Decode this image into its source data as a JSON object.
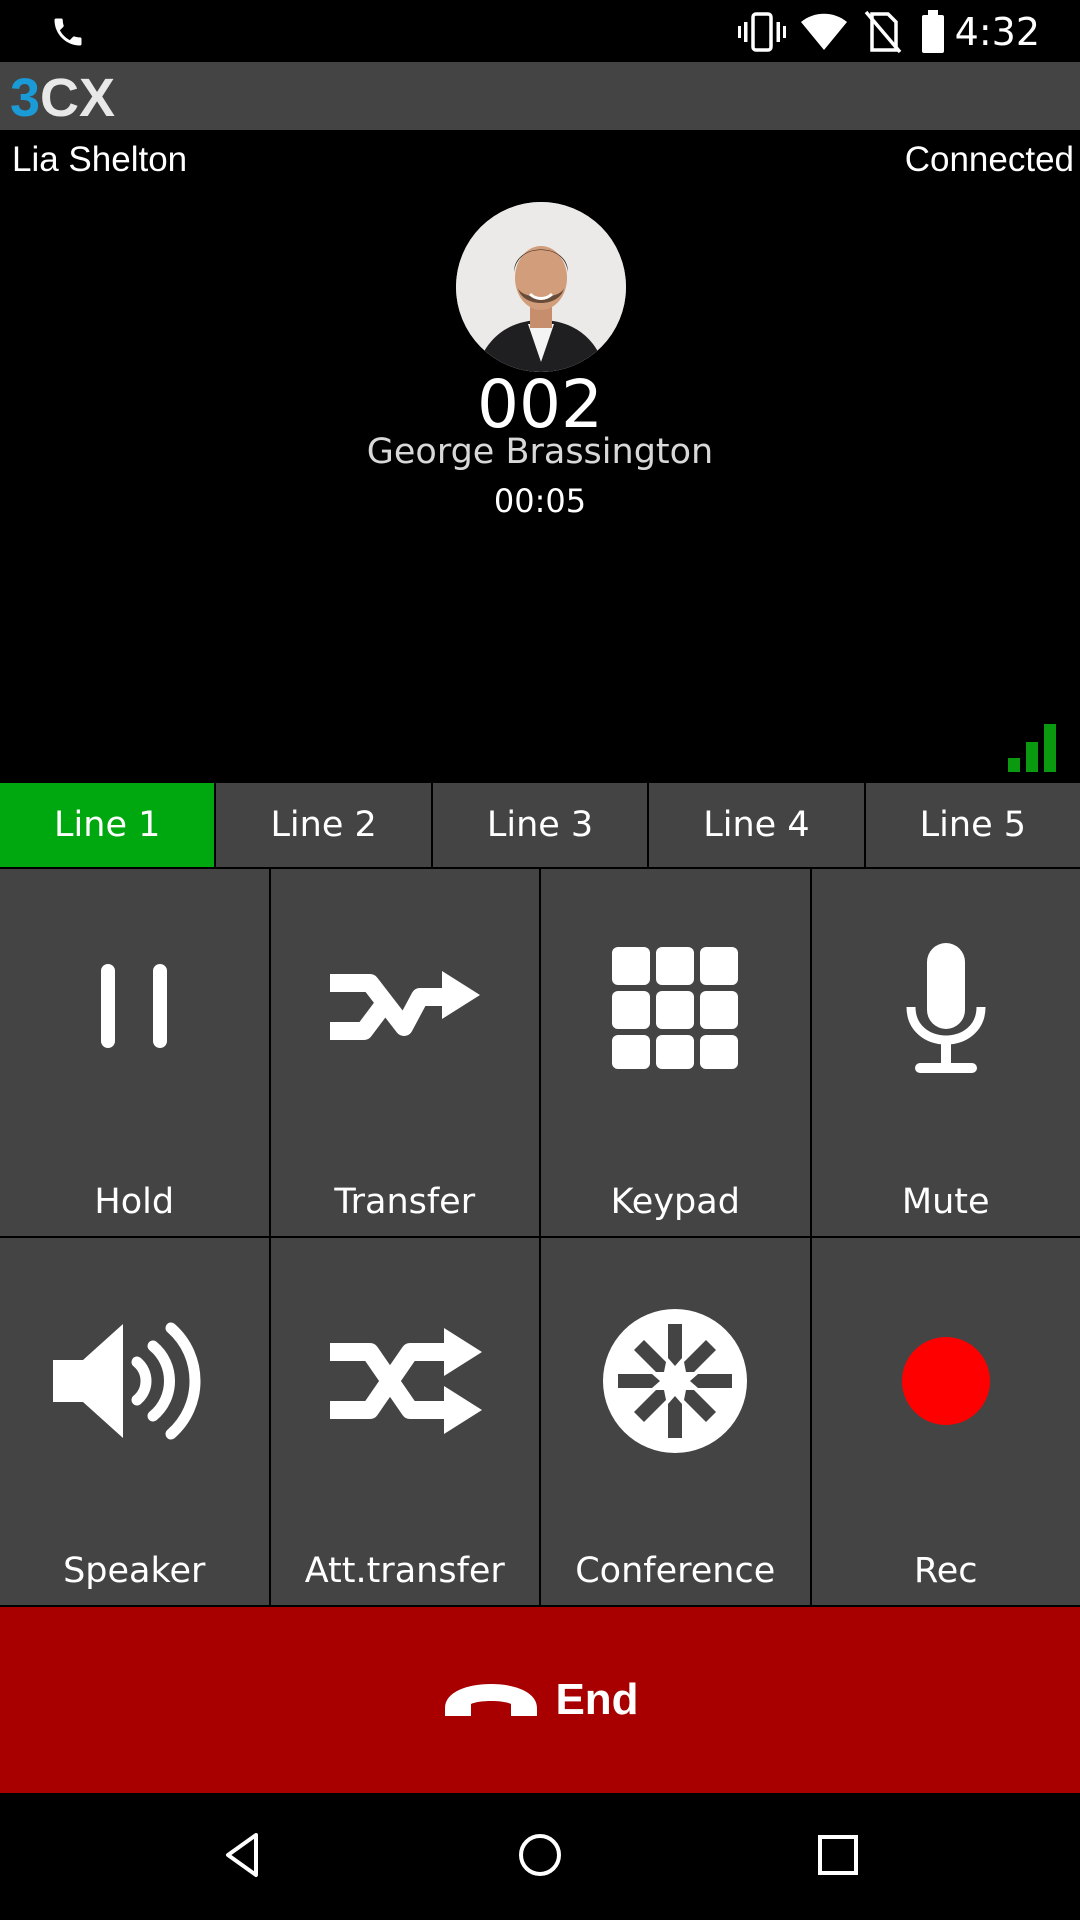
{
  "status_bar": {
    "time": "4:32",
    "icons": [
      "phone-call-icon",
      "vibrate-icon",
      "wifi-icon",
      "no-sim-icon",
      "battery-icon"
    ]
  },
  "app": {
    "logo_text": "3CX",
    "brand_blue": "#1a9ad6"
  },
  "call": {
    "local_user": "Lia Shelton",
    "status": "Connected",
    "extension": "002",
    "contact_name": "George Brassington",
    "duration": "00:05",
    "signal_color": "#0a9a10"
  },
  "lines": [
    {
      "label": "Line 1",
      "active": true
    },
    {
      "label": "Line 2",
      "active": false
    },
    {
      "label": "Line 3",
      "active": false
    },
    {
      "label": "Line 4",
      "active": false
    },
    {
      "label": "Line 5",
      "active": false
    }
  ],
  "line_active_color": "#00a80f",
  "actions": [
    {
      "label": "Hold",
      "icon": "pause-icon"
    },
    {
      "label": "Transfer",
      "icon": "transfer-icon"
    },
    {
      "label": "Keypad",
      "icon": "keypad-icon"
    },
    {
      "label": "Mute",
      "icon": "microphone-icon"
    },
    {
      "label": "Speaker",
      "icon": "speaker-icon"
    },
    {
      "label": "Att.transfer",
      "icon": "att-transfer-icon"
    },
    {
      "label": "Conference",
      "icon": "conference-icon"
    },
    {
      "label": "Rec",
      "icon": "record-icon"
    }
  ],
  "end_call": {
    "label": "End",
    "color": "#a80000"
  },
  "nav": [
    "back-icon",
    "home-icon",
    "recents-icon"
  ]
}
